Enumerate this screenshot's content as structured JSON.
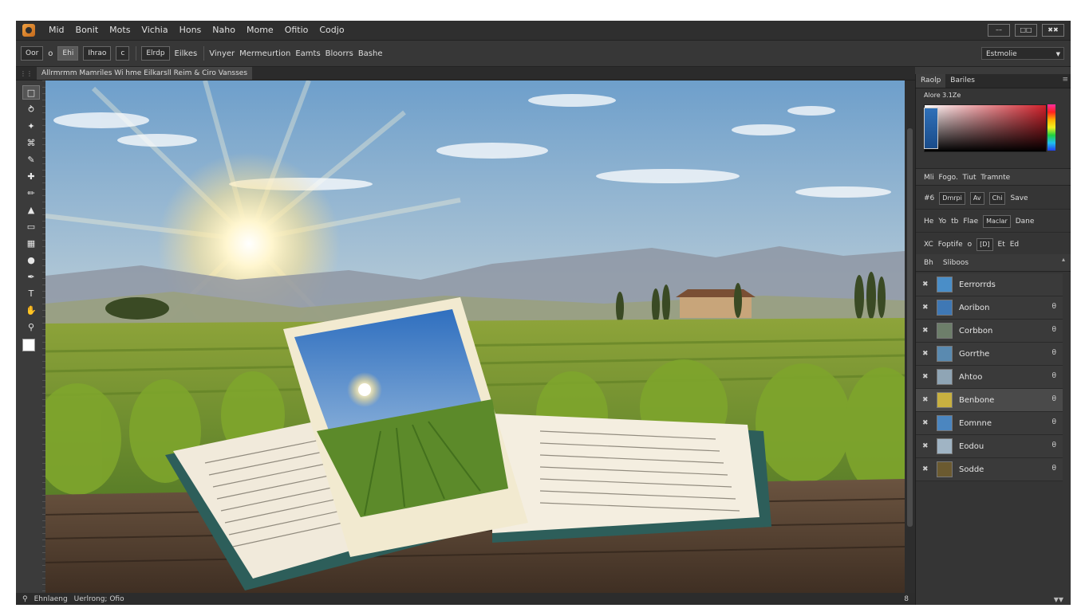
{
  "menubar": {
    "items": [
      "Mid",
      "Bonit",
      "Mots",
      "Vichia",
      "Hons",
      "Naho",
      "Mome",
      "Ofitio",
      "Codjo"
    ],
    "window_controls": [
      "––",
      "□□",
      "✖✖"
    ]
  },
  "optionsbar": {
    "items": [
      "Oor",
      "o",
      "Ehi",
      "Ihrao",
      "c",
      "Elrdp",
      "Eilkes",
      "Vinyer",
      "Mermeurtion",
      "Eamts",
      "Bloorrs",
      "Bashe"
    ],
    "workspace": "Estmolie"
  },
  "tab": {
    "title": "Allrmrmm Mamriles Wi hme   Eilkarsll Reim & Ciro Vansses"
  },
  "tools": [
    "rectangle-select",
    "lasso",
    "magic-wand",
    "crop",
    "eyedropper",
    "healing-brush",
    "brush",
    "clone-stamp",
    "eraser",
    "gradient",
    "blur",
    "pen",
    "type",
    "hand",
    "zoom"
  ],
  "statusbar": {
    "left": "Ehnlaeng",
    "middle": "Uerlrong; Ofio",
    "right": "8"
  },
  "panel": {
    "tabs": [
      "Raolp",
      "Bariles"
    ],
    "color_label": "Alore 3.1Ze",
    "properties": {
      "title_parts": [
        "Mli",
        "Fogo.",
        "Tiut",
        "Tramnte"
      ],
      "row1": [
        "#6",
        "Dmrpi",
        "Av",
        "Chi",
        "Save"
      ],
      "row2": [
        "He",
        "Yo",
        "tb",
        "Flae",
        "Maclar",
        "Dane"
      ],
      "row3": [
        "XC",
        "Foptife",
        "o",
        "[D]",
        "Et",
        "Ed"
      ]
    },
    "layers_header": [
      "Bh",
      "Sliboos"
    ],
    "layers": [
      {
        "name": "Eerrorrds",
        "thumb": "#4a8ec8",
        "lock": ""
      },
      {
        "name": "Aoribon",
        "thumb": "#3f78b5",
        "lock": "θ"
      },
      {
        "name": "Corbbon",
        "thumb": "#6d7e6a",
        "lock": "θ"
      },
      {
        "name": "Gorrthe",
        "thumb": "#5a8ab0",
        "lock": "θ"
      },
      {
        "name": "Ahtoo",
        "thumb": "#8fa5b5",
        "lock": "θ"
      },
      {
        "name": "Benbone",
        "thumb": "#c8b040",
        "lock": "θ"
      },
      {
        "name": "Eomnne",
        "thumb": "#4b86c0",
        "lock": "θ"
      },
      {
        "name": "Eodou",
        "thumb": "#a0b4c4",
        "lock": "θ"
      },
      {
        "name": "Sodde",
        "thumb": "#6b5a30",
        "lock": "θ"
      }
    ],
    "selected_layer": 5,
    "footer": "▼▼"
  },
  "colors": {
    "accent": "#3a3a3a",
    "canvas_bg": "#7aa7cf"
  }
}
